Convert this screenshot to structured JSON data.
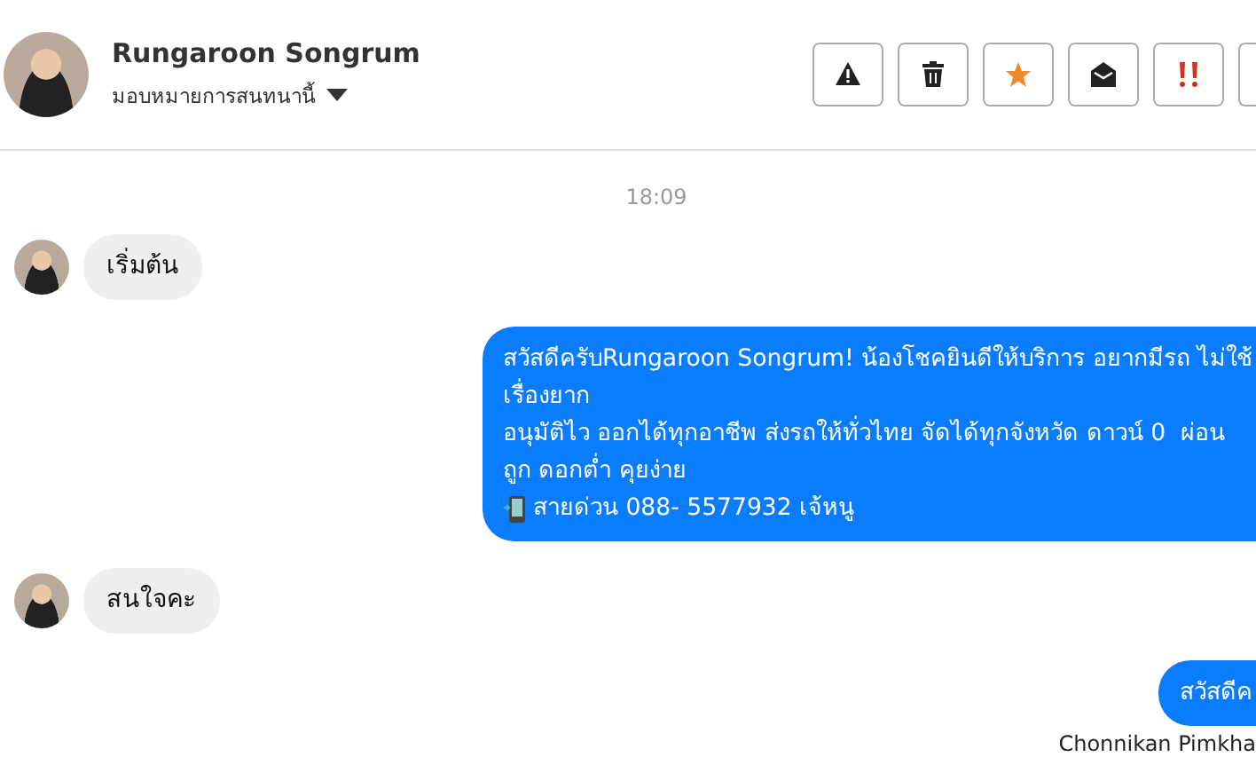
{
  "header": {
    "name": "Rungaroon Songrum",
    "subtitle": "มอบหมายการสนทนานี้"
  },
  "messages": [
    {
      "kind": "time",
      "text": "18:09"
    },
    {
      "kind": "incoming",
      "lines": [
        "เริ่มต้น"
      ]
    },
    {
      "kind": "outgoing",
      "lines": [
        "สวัสดีครับRungaroon Songrum! น้องโชคยินดีให้บริการ อยากมีรถ ไม่ใช้",
        "เรื่องยาก",
        "อนุมัติไว ออกได้ทุกอาชีพ ส่งรถให้ทั่วไทย จัดได้ทุกจังหวัด ดาวน์ 0  ผ่อน",
        "ถูก ดอกต่ำ คุยง่าย",
        {
          "kind": "hotline",
          "text": "สายด่วน 088- 5577932 เจ้หนู"
        }
      ]
    },
    {
      "kind": "incoming",
      "lines": [
        "สนใจคะ"
      ]
    },
    {
      "kind": "outgoing",
      "lines": [
        "สวัสดีค"
      ],
      "sender": "Chonnikan Pimkha"
    }
  ]
}
